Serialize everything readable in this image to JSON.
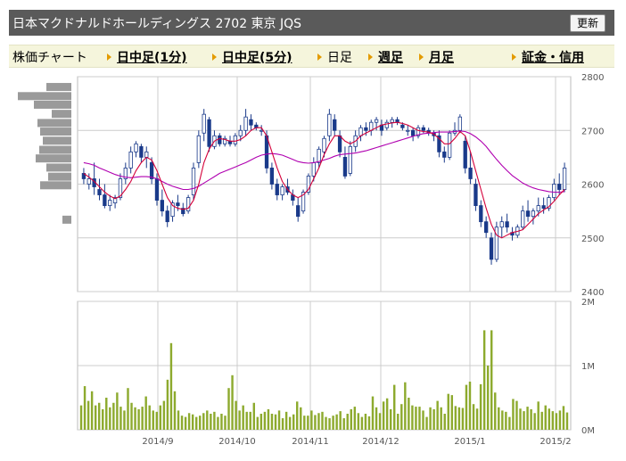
{
  "header": {
    "title": "日本マクドナルドホールディングス  2702  東京 JQS",
    "refresh_label": "更新"
  },
  "nav": {
    "label": "株価チャート",
    "items": [
      {
        "label": "日中足(1分)",
        "link": true
      },
      {
        "label": "日中足(5分)",
        "link": true
      },
      {
        "label": "日足",
        "link": false
      },
      {
        "label": "週足",
        "link": true
      },
      {
        "label": "月足",
        "link": true
      },
      {
        "label": "証金・信用",
        "link": true
      }
    ]
  },
  "colors": {
    "candle_up": "#ffffff",
    "candle_down": "#1a3a8a",
    "ma_short": "#d4003a",
    "ma_long": "#b000b0",
    "volume_bar": "#8daa2e",
    "profile_bar": "#9a9a9a",
    "grid": "#cccccc"
  },
  "chart_data": [
    {
      "type": "candlestick",
      "title": "",
      "ylim": [
        2400,
        2800
      ],
      "yticks": [
        "2400",
        "2500",
        "2600",
        "2700",
        "2800"
      ],
      "xticks": [
        "2014/9",
        "2014/10",
        "2014/11",
        "2014/12",
        "2015/1",
        "2015/2"
      ],
      "moving_averages": [
        "short",
        "long"
      ],
      "price_volume_profile": "left",
      "ohlc": [
        [
          2620,
          2630,
          2600,
          2610
        ],
        [
          2600,
          2620,
          2590,
          2610
        ],
        [
          2610,
          2640,
          2580,
          2595
        ],
        [
          2590,
          2610,
          2570,
          2580
        ],
        [
          2580,
          2600,
          2555,
          2560
        ],
        [
          2560,
          2580,
          2550,
          2570
        ],
        [
          2565,
          2580,
          2555,
          2575
        ],
        [
          2575,
          2620,
          2570,
          2610
        ],
        [
          2610,
          2640,
          2600,
          2630
        ],
        [
          2630,
          2670,
          2620,
          2660
        ],
        [
          2660,
          2680,
          2650,
          2675
        ],
        [
          2670,
          2675,
          2640,
          2650
        ],
        [
          2650,
          2670,
          2630,
          2660
        ],
        [
          2640,
          2650,
          2600,
          2610
        ],
        [
          2610,
          2620,
          2560,
          2570
        ],
        [
          2570,
          2590,
          2540,
          2550
        ],
        [
          2550,
          2560,
          2520,
          2530
        ],
        [
          2540,
          2570,
          2530,
          2565
        ],
        [
          2565,
          2580,
          2550,
          2560
        ],
        [
          2555,
          2565,
          2540,
          2545
        ],
        [
          2550,
          2580,
          2545,
          2575
        ],
        [
          2580,
          2640,
          2570,
          2630
        ],
        [
          2640,
          2700,
          2630,
          2690
        ],
        [
          2695,
          2740,
          2680,
          2730
        ],
        [
          2720,
          2725,
          2660,
          2670
        ],
        [
          2670,
          2700,
          2665,
          2690
        ],
        [
          2690,
          2695,
          2670,
          2675
        ],
        [
          2675,
          2690,
          2670,
          2685
        ],
        [
          2680,
          2690,
          2670,
          2675
        ],
        [
          2675,
          2695,
          2670,
          2690
        ],
        [
          2690,
          2710,
          2680,
          2700
        ],
        [
          2700,
          2740,
          2690,
          2725
        ],
        [
          2720,
          2730,
          2700,
          2710
        ],
        [
          2710,
          2715,
          2700,
          2705
        ],
        [
          2700,
          2710,
          2690,
          2700
        ],
        [
          2690,
          2700,
          2620,
          2630
        ],
        [
          2630,
          2640,
          2590,
          2600
        ],
        [
          2600,
          2610,
          2570,
          2580
        ],
        [
          2580,
          2600,
          2570,
          2595
        ],
        [
          2595,
          2610,
          2580,
          2585
        ],
        [
          2580,
          2590,
          2560,
          2570
        ],
        [
          2560,
          2575,
          2530,
          2540
        ],
        [
          2550,
          2590,
          2545,
          2585
        ],
        [
          2585,
          2620,
          2580,
          2615
        ],
        [
          2615,
          2650,
          2605,
          2640
        ],
        [
          2640,
          2670,
          2630,
          2665
        ],
        [
          2660,
          2690,
          2650,
          2685
        ],
        [
          2690,
          2740,
          2680,
          2730
        ],
        [
          2720,
          2730,
          2690,
          2700
        ],
        [
          2690,
          2700,
          2650,
          2660
        ],
        [
          2650,
          2670,
          2610,
          2615
        ],
        [
          2620,
          2680,
          2615,
          2670
        ],
        [
          2670,
          2700,
          2660,
          2690
        ],
        [
          2690,
          2710,
          2680,
          2705
        ],
        [
          2705,
          2715,
          2690,
          2700
        ],
        [
          2700,
          2720,
          2690,
          2715
        ],
        [
          2715,
          2725,
          2700,
          2720
        ],
        [
          2710,
          2720,
          2690,
          2700
        ],
        [
          2705,
          2720,
          2700,
          2715
        ],
        [
          2715,
          2725,
          2705,
          2720
        ],
        [
          2720,
          2725,
          2710,
          2715
        ],
        [
          2710,
          2715,
          2700,
          2705
        ],
        [
          2700,
          2710,
          2690,
          2700
        ],
        [
          2700,
          2705,
          2680,
          2690
        ],
        [
          2690,
          2710,
          2685,
          2705
        ],
        [
          2705,
          2710,
          2695,
          2700
        ],
        [
          2700,
          2705,
          2690,
          2695
        ],
        [
          2695,
          2700,
          2680,
          2690
        ],
        [
          2690,
          2700,
          2650,
          2660
        ],
        [
          2660,
          2670,
          2640,
          2650
        ],
        [
          2650,
          2700,
          2645,
          2695
        ],
        [
          2695,
          2715,
          2690,
          2700
        ],
        [
          2700,
          2730,
          2695,
          2725
        ],
        [
          2680,
          2690,
          2620,
          2630
        ],
        [
          2630,
          2660,
          2600,
          2610
        ],
        [
          2600,
          2610,
          2550,
          2560
        ],
        [
          2560,
          2570,
          2520,
          2530
        ],
        [
          2530,
          2540,
          2500,
          2510
        ],
        [
          2500,
          2510,
          2450,
          2460
        ],
        [
          2460,
          2530,
          2455,
          2520
        ],
        [
          2520,
          2540,
          2500,
          2530
        ],
        [
          2530,
          2545,
          2510,
          2520
        ],
        [
          2510,
          2520,
          2495,
          2505
        ],
        [
          2505,
          2525,
          2500,
          2520
        ],
        [
          2520,
          2560,
          2515,
          2550
        ],
        [
          2550,
          2570,
          2530,
          2540
        ],
        [
          2540,
          2555,
          2525,
          2550
        ],
        [
          2550,
          2575,
          2540,
          2560
        ],
        [
          2560,
          2575,
          2545,
          2555
        ],
        [
          2555,
          2580,
          2550,
          2575
        ],
        [
          2575,
          2610,
          2570,
          2600
        ],
        [
          2600,
          2620,
          2580,
          2590
        ],
        [
          2590,
          2640,
          2585,
          2630
        ]
      ],
      "ma_short": [
        2620,
        2613,
        2605,
        2595,
        2585,
        2578,
        2573,
        2578,
        2590,
        2605,
        2625,
        2640,
        2650,
        2645,
        2625,
        2600,
        2575,
        2560,
        2555,
        2553,
        2555,
        2570,
        2600,
        2640,
        2665,
        2680,
        2685,
        2683,
        2680,
        2680,
        2683,
        2690,
        2700,
        2705,
        2705,
        2690,
        2660,
        2630,
        2605,
        2590,
        2580,
        2575,
        2580,
        2590,
        2610,
        2630,
        2655,
        2675,
        2690,
        2690,
        2680,
        2675,
        2680,
        2690,
        2695,
        2700,
        2705,
        2710,
        2712,
        2714,
        2715,
        2713,
        2710,
        2705,
        2700,
        2698,
        2697,
        2693,
        2685,
        2675,
        2675,
        2685,
        2698,
        2690,
        2660,
        2625,
        2590,
        2555,
        2525,
        2505,
        2500,
        2505,
        2510,
        2512,
        2515,
        2525,
        2535,
        2545,
        2552,
        2558,
        2568,
        2580,
        2590
      ],
      "ma_long": [
        2640,
        2638,
        2635,
        2630,
        2626,
        2622,
        2618,
        2615,
        2613,
        2612,
        2613,
        2614,
        2614,
        2613,
        2610,
        2605,
        2600,
        2596,
        2593,
        2590,
        2590,
        2592,
        2596,
        2602,
        2608,
        2614,
        2620,
        2624,
        2628,
        2632,
        2636,
        2640,
        2645,
        2650,
        2654,
        2656,
        2657,
        2656,
        2654,
        2650,
        2646,
        2642,
        2640,
        2639,
        2640,
        2642,
        2645,
        2648,
        2652,
        2655,
        2656,
        2657,
        2658,
        2660,
        2662,
        2665,
        2668,
        2671,
        2674,
        2677,
        2680,
        2683,
        2686,
        2689,
        2692,
        2694,
        2695,
        2696,
        2697,
        2697,
        2697,
        2698,
        2699,
        2698,
        2694,
        2688,
        2680,
        2670,
        2658,
        2646,
        2635,
        2625,
        2616,
        2609,
        2602,
        2597,
        2593,
        2590,
        2588,
        2586,
        2585,
        2585,
        2586
      ]
    },
    {
      "type": "bar",
      "title": "",
      "ylim": [
        0,
        2000000
      ],
      "yticks": [
        "0M",
        "1M",
        "2M"
      ],
      "values": [
        380000,
        680000,
        450000,
        600000,
        380000,
        420000,
        320000,
        500000,
        350000,
        420000,
        580000,
        360000,
        300000,
        650000,
        420000,
        350000,
        320000,
        360000,
        520000,
        380000,
        300000,
        280000,
        380000,
        450000,
        780000,
        1350000,
        600000,
        300000,
        220000,
        200000,
        260000,
        240000,
        200000,
        220000,
        260000,
        300000,
        250000,
        280000,
        200000,
        250000,
        220000,
        650000,
        850000,
        450000,
        300000,
        380000,
        280000,
        280000,
        420000,
        200000,
        250000,
        280000,
        320000,
        250000,
        240000,
        300000,
        180000,
        280000,
        200000,
        240000,
        440000,
        350000,
        220000,
        220000,
        300000,
        230000,
        260000,
        280000,
        200000,
        180000,
        220000,
        240000,
        290000,
        180000,
        250000,
        320000,
        360000,
        260000,
        200000,
        250000,
        210000,
        520000,
        350000,
        260000,
        440000,
        490000,
        320000,
        700000,
        250000,
        400000,
        740000,
        500000,
        380000,
        360000,
        360000,
        300000,
        200000,
        350000,
        320000,
        450000,
        350000,
        250000,
        560000,
        540000,
        370000,
        350000,
        340000,
        700000,
        750000,
        400000,
        330000,
        710000,
        1550000,
        1000000,
        1550000,
        580000,
        350000,
        300000,
        280000,
        200000,
        480000,
        450000,
        330000,
        290000,
        360000,
        320000,
        260000,
        440000,
        280000,
        380000,
        330000,
        290000,
        260000,
        300000,
        370000,
        270000
      ]
    }
  ]
}
